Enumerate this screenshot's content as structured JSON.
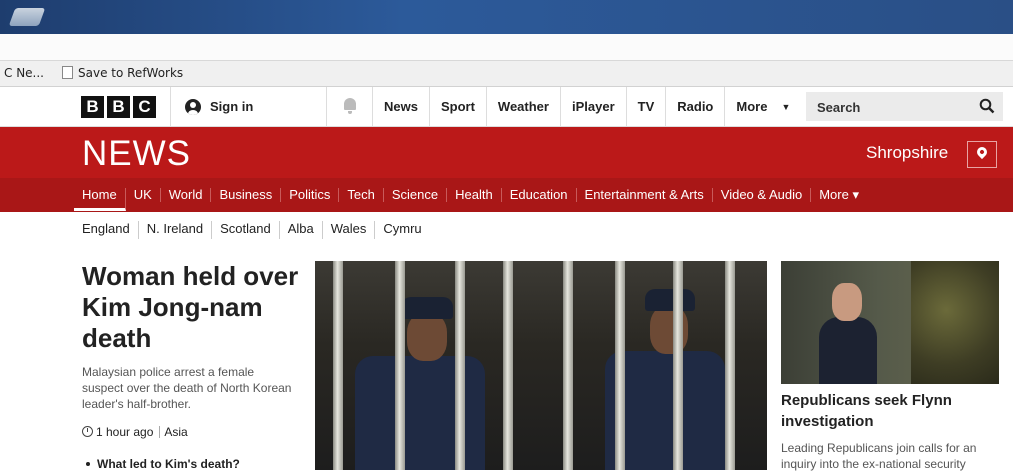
{
  "bookmarks": {
    "items": [
      "C Ne...",
      "Save to RefWorks"
    ]
  },
  "bbc": {
    "logo_letters": [
      "B",
      "B",
      "C"
    ],
    "sign_in": "Sign in",
    "nav": [
      "News",
      "Sport",
      "Weather",
      "iPlayer",
      "TV",
      "Radio",
      "More"
    ],
    "search_placeholder": "Search"
  },
  "news": {
    "title": "NEWS",
    "location": "Shropshire",
    "sections": [
      "Home",
      "UK",
      "World",
      "Business",
      "Politics",
      "Tech",
      "Science",
      "Health",
      "Education",
      "Entertainment & Arts",
      "Video & Audio",
      "More ▾"
    ],
    "subsections": [
      "England",
      "N. Ireland",
      "Scotland",
      "Alba",
      "Wales",
      "Cymru"
    ]
  },
  "main_story": {
    "headline": "Woman held over Kim Jong-nam death",
    "summary": "Malaysian police arrest a female suspect over the death of North Korean leader's half-brother.",
    "time": "1 hour ago",
    "tag": "Asia",
    "related": "What led to Kim's death?"
  },
  "side_story": {
    "headline": "Republicans seek Flynn investigation",
    "summary": "Leading Republicans join calls for an inquiry into the ex-national security"
  },
  "colors": {
    "bbc_red": "#bb1919",
    "section_red": "#a91717"
  }
}
